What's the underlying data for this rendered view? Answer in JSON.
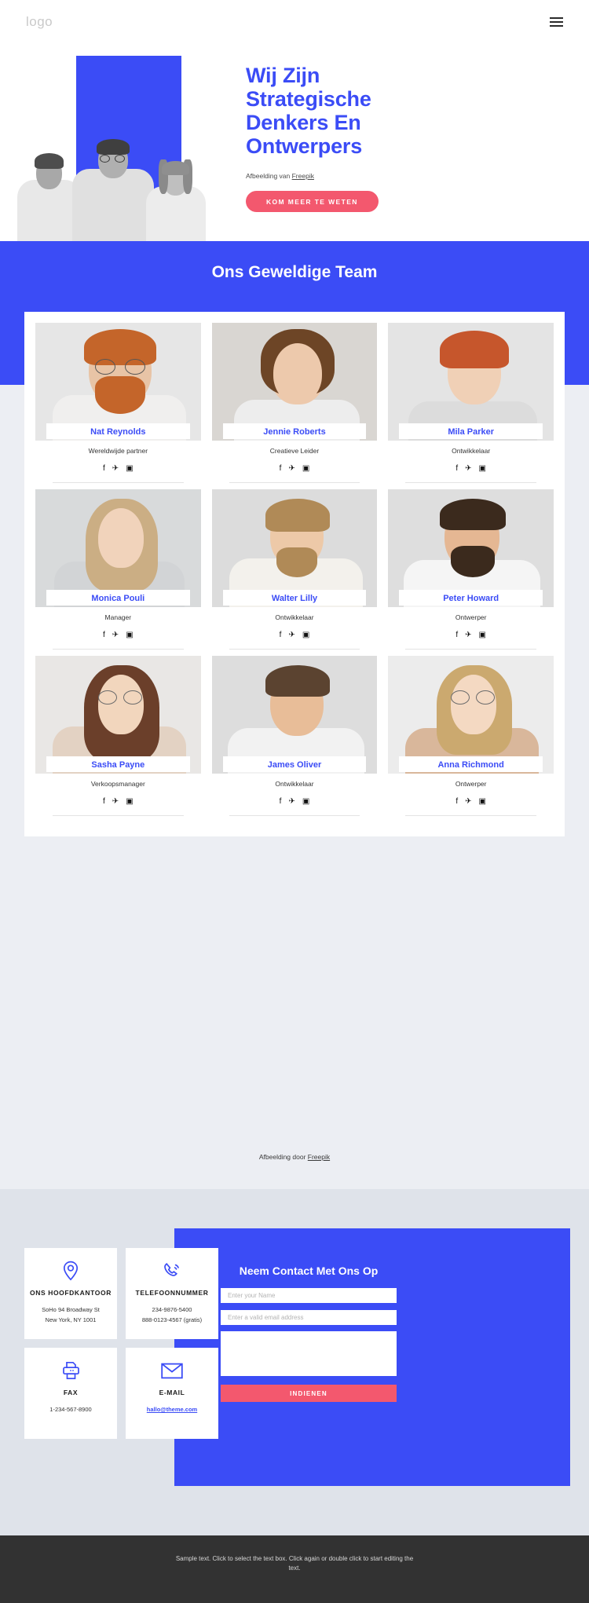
{
  "header": {
    "logo": "logo",
    "menu_icon": "hamburger-icon"
  },
  "hero": {
    "title": "Wij Zijn Strategische Denkers En Ontwerpers",
    "credit_prefix": "Afbeelding van ",
    "credit_link": "Freepik",
    "cta_label": "KOM MEER TE WETEN"
  },
  "team": {
    "heading": "Ons Geweldige Team",
    "credit_prefix": "Afbeelding door ",
    "credit_link": "Freepik",
    "social": {
      "facebook": "f",
      "twitter": "✈",
      "instagram": "▣"
    },
    "members": [
      {
        "name": "Nat Reynolds",
        "role": "Wereldwijde partner"
      },
      {
        "name": "Jennie Roberts",
        "role": "Creatieve Leider"
      },
      {
        "name": "Mila Parker",
        "role": "Ontwikkelaar"
      },
      {
        "name": "Monica Pouli",
        "role": "Manager"
      },
      {
        "name": "Walter Lilly",
        "role": "Ontwikkelaar"
      },
      {
        "name": "Peter Howard",
        "role": "Ontwerper"
      },
      {
        "name": "Sasha Payne",
        "role": "Verkoopsmanager"
      },
      {
        "name": "James Oliver",
        "role": "Ontwikkelaar"
      },
      {
        "name": "Anna Richmond",
        "role": "Ontwerper"
      }
    ]
  },
  "contact": {
    "cards": [
      {
        "icon": "location-pin-icon",
        "title": "ONS HOOFDKANTOOR",
        "line1": "SoHo 94 Broadway St",
        "line2": "New York, NY 1001"
      },
      {
        "icon": "phone-icon",
        "title": "TELEFOONNUMMER",
        "line1": "234-9876-5400",
        "line2": "888-0123-4567 (gratis)"
      },
      {
        "icon": "fax-printer-icon",
        "title": "FAX",
        "line1": "1-234-567-8900",
        "line2": ""
      },
      {
        "icon": "envelope-icon",
        "title": "E-MAIL",
        "line1": "hallo@theme.com",
        "line2": ""
      }
    ],
    "form": {
      "title": "Neem Contact Met Ons Op",
      "name_placeholder": "Enter your Name",
      "email_placeholder": "Enter a valid email address",
      "message_placeholder": "",
      "submit_label": "INDIENEN"
    }
  },
  "footer": {
    "text": "Sample text. Click to select the text box. Click again or double click to start editing the text."
  },
  "colors": {
    "brand_blue": "#3b4cf6",
    "accent_pink": "#f3586e",
    "band_grey": "#dfe3ea",
    "footer_dark": "#323232"
  }
}
